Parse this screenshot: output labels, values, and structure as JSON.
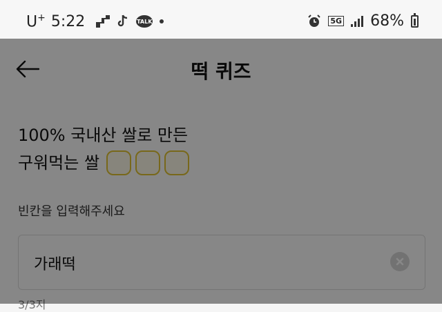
{
  "status_bar": {
    "carrier": "U",
    "carrier_sup": "+",
    "time": "5:22",
    "talk_badge": "TALK",
    "network": "5G",
    "battery": "68%"
  },
  "header": {
    "title": "떡 퀴즈"
  },
  "quiz": {
    "question_line1": "100% 국내산 쌀로 만든",
    "question_line2": "구워먹는 쌀",
    "blank_count": 3,
    "instruction": "빈칸을 입력해주세요",
    "answer_value": "가래떡",
    "progress": "3/3지"
  },
  "colors": {
    "overlay": "rgba(0,0,0,0.47)",
    "blank_border": "#e3c531",
    "blank_fill": "#fffbea"
  },
  "icons": [
    "back-arrow-icon",
    "clear-icon",
    "alarm-icon",
    "signal-icon",
    "battery-icon",
    "tiktok-icon",
    "kakaotalk-icon"
  ]
}
